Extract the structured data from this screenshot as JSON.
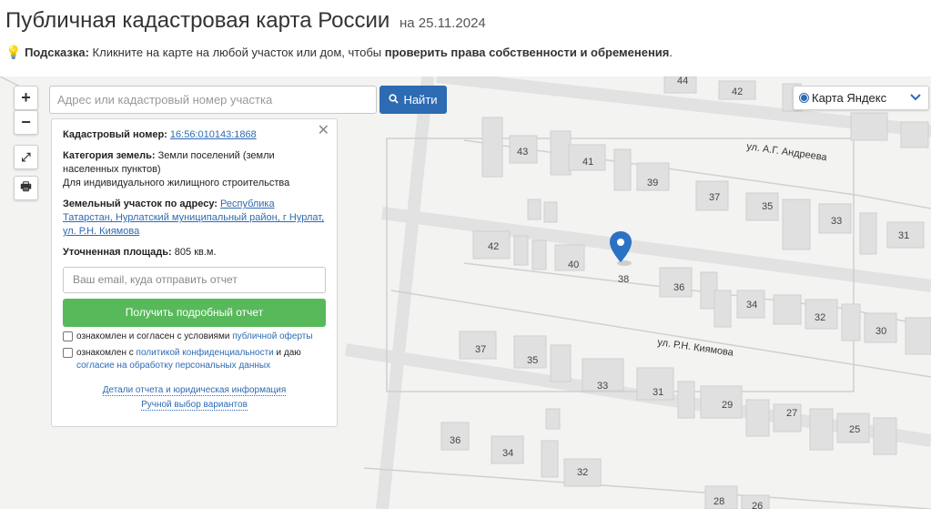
{
  "header": {
    "title": "Публичная кадастровая карта России",
    "date": "на 25.11.2024"
  },
  "hint": {
    "prefix": "Подсказка:",
    "text": "Кликните на карте на любой участок или дом, чтобы",
    "emphasis": "проверить права собственности и обременения",
    "suffix": "."
  },
  "controls": {
    "zoom_in": "+",
    "zoom_out": "−",
    "fullscreen_icon": "expand-icon",
    "print_icon": "printer-icon"
  },
  "search": {
    "placeholder": "Адрес или кадастровый номер участка",
    "button": "Найти"
  },
  "layer": {
    "selected": "Карта Яндекс"
  },
  "panel": {
    "cadastral_label": "Кадастровый номер:",
    "cadastral_value": "16:56:010143:1868",
    "category_label": "Категория земель:",
    "category_value": "Земли поселений (земли населенных пунктов)",
    "category_use": "Для индивидуального жилищного строительства",
    "address_label": "Земельный участок по адресу:",
    "address_value": "Республика Татарстан, Нурлатский муниципальный район, г Нурлат, ул. Р.Н. Киямова",
    "area_label": "Уточненная площадь:",
    "area_value": "805 кв.м.",
    "email_placeholder": "Ваш email, куда отправить отчет",
    "report_button": "Получить подробный отчет",
    "consent1_pre": "ознакомлен и согласен с условиями",
    "consent1_link": "публичной оферты",
    "consent2_pre": "ознакомлен с",
    "consent2_link1": "политикой конфиденциальности",
    "consent2_mid": "и даю",
    "consent2_link2": "согласие на обработку персональных данных",
    "details_link": "Детали отчета и юридическая информация",
    "manual_link": "Ручной выбор вариантов"
  },
  "map": {
    "streets": [
      "ул. А.Г. Андреева",
      "ул. Р.Н. Киямова"
    ],
    "house_numbers": [
      "44",
      "42",
      "43",
      "41",
      "39",
      "37",
      "35",
      "33",
      "31",
      "42",
      "40",
      "38",
      "36",
      "34",
      "32",
      "30",
      "37",
      "35",
      "33",
      "31",
      "29",
      "27",
      "25",
      "36",
      "34",
      "32",
      "28",
      "26"
    ]
  }
}
